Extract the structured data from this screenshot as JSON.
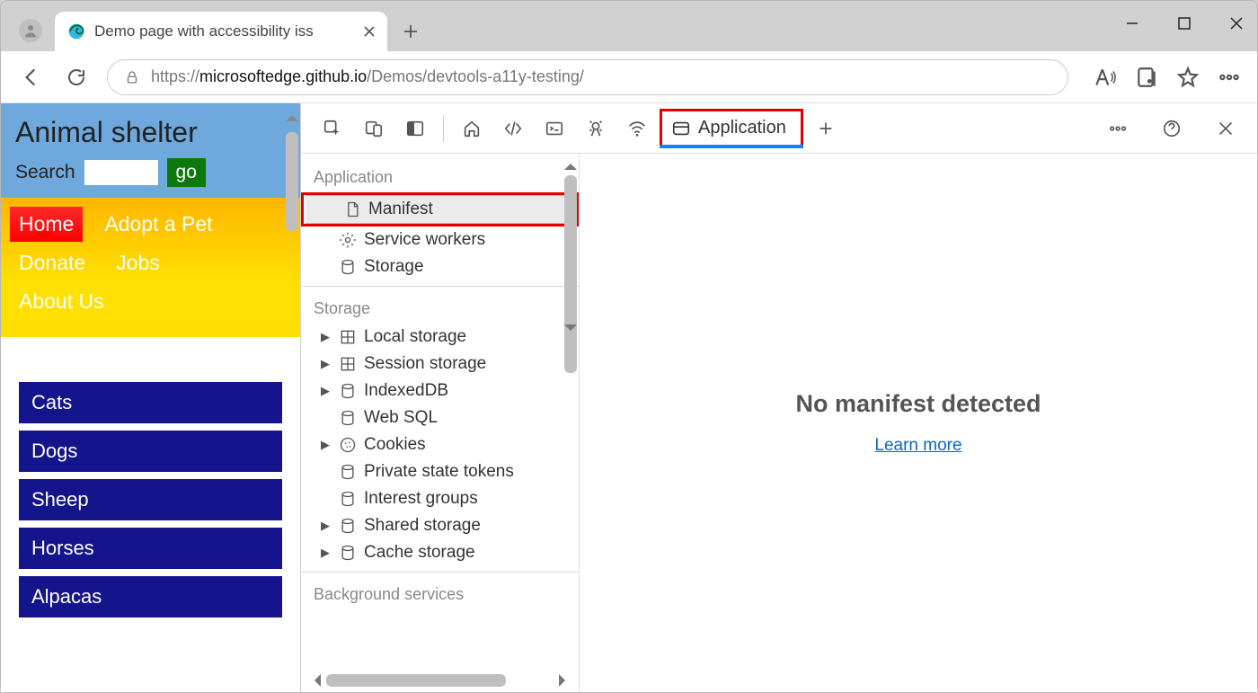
{
  "browser": {
    "tab_title": "Demo page with accessibility iss",
    "url_prefix": "https://",
    "url_host": "microsoftedge.github.io",
    "url_path": "/Demos/devtools-a11y-testing/"
  },
  "page": {
    "title": "Animal shelter",
    "search_label": "Search",
    "go_label": "go",
    "nav": {
      "home": "Home",
      "adopt": "Adopt a Pet",
      "donate": "Donate",
      "jobs": "Jobs",
      "about": "About Us"
    },
    "animals": [
      "Cats",
      "Dogs",
      "Sheep",
      "Horses",
      "Alpacas"
    ]
  },
  "devtools": {
    "active_tab": "Application",
    "groups": {
      "application": {
        "title": "Application",
        "items": [
          "Manifest",
          "Service workers",
          "Storage"
        ]
      },
      "storage": {
        "title": "Storage",
        "items": [
          "Local storage",
          "Session storage",
          "IndexedDB",
          "Web SQL",
          "Cookies",
          "Private state tokens",
          "Interest groups",
          "Shared storage",
          "Cache storage"
        ]
      },
      "bg": {
        "title": "Background services"
      }
    },
    "main": {
      "message": "No manifest detected",
      "link": "Learn more"
    }
  }
}
